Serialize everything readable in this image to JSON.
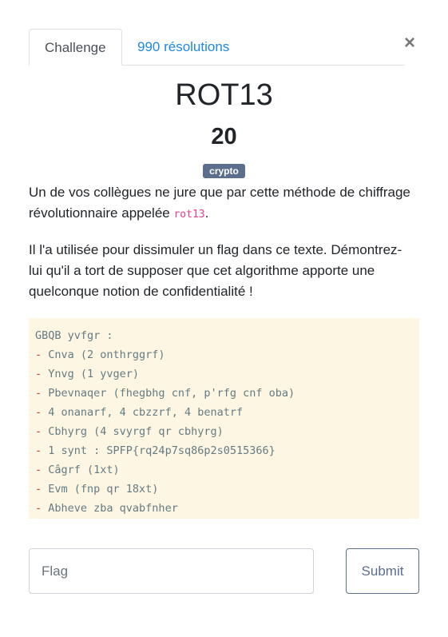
{
  "tabs": [
    {
      "label": "Challenge",
      "active": true
    },
    {
      "label": "990 résolutions",
      "active": false
    }
  ],
  "close_icon": "×",
  "challenge": {
    "title": "ROT13",
    "points": "20",
    "category": "crypto",
    "desc1_before": "Un de vos collègues ne jure que par cette méthode de chiffrage révolutionnaire appelée ",
    "desc1_code": "rot13",
    "desc1_after": ".",
    "desc2": "Il l'a utilisée pour dissimuler un flag dans ce texte. Démontrez-lui qu'il a tort de supposer que cet algorithme apporte une quelconque notion de confidentialité !",
    "code_header": "GBQB yvfgr :",
    "code_lines": [
      "Cnva (2 onthrggrf)",
      "Ynvg (1 yvger)",
      "Pbevnaqer (fhegbhg cnf, p'rfg cnf oba)",
      "4 onanarf, 4 cbzzrf, 4 benatrf",
      "Cbhyrg (4 svyrgf qr cbhyrg)",
      "1 synt : SPFP{rq24p7sq86p2s0515366}",
      "Câgrf (1xt)",
      "Evm (fnp qr 18xt)",
      "Abheve zba qvabfnher"
    ]
  },
  "form": {
    "placeholder": "Flag",
    "value": "",
    "submit_label": "Submit"
  },
  "colors": {
    "accent": "#1e88e5",
    "badge": "#5b6e8c",
    "code_bg": "#fdf6e3"
  }
}
